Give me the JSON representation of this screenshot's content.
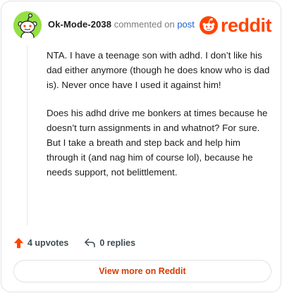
{
  "comment": {
    "username": "Ok-Mode-2038",
    "commented_text": "commented on",
    "post_link": "post",
    "paragraphs": [
      "NTA. I have a teenage son with adhd. I don’t like his dad either anymore (though he does know who is dad is). Never once have I used it against him!",
      "Does his adhd drive me bonkers at times because he doesn’t turn assignments in and whatnot? For sure. But I take a breath and step back and help him through it (and nag him of course lol), because he needs support, not belittlement."
    ]
  },
  "brand": {
    "wordmark": "reddit",
    "color": "#ff4500",
    "icon": "reddit-snoo-icon"
  },
  "avatar": {
    "icon": "snoo-avatar-icon",
    "background": "#94e044"
  },
  "actions": {
    "upvotes_label": "4 upvotes",
    "replies_label": "0 replies",
    "upvote_icon": "upvote-arrow-icon",
    "reply_icon": "reply-arrow-icon",
    "upvote_color": "#ff4500"
  },
  "footer": {
    "view_more_label": "View more on Reddit",
    "color": "#d93a00"
  }
}
